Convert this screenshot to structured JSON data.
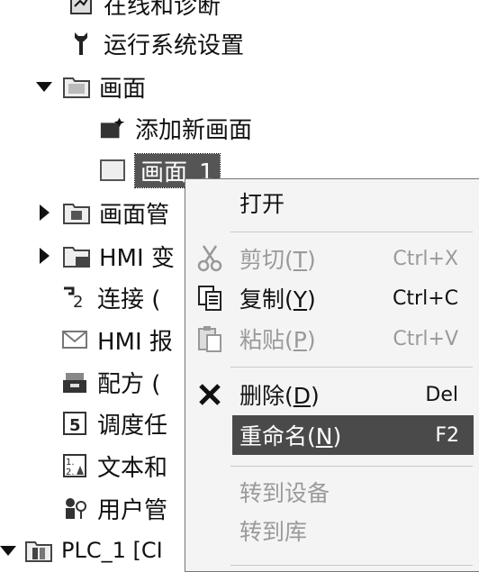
{
  "tree": {
    "items": [
      {
        "label": "在线和诊断",
        "icon": "online-diagnostics-icon"
      },
      {
        "label": "运行系统设置",
        "icon": "wrench-icon"
      },
      {
        "label": "画面",
        "icon": "folder-icon"
      },
      {
        "label": "添加新画面",
        "icon": "add-screen-icon"
      },
      {
        "label": "画面_1",
        "icon": "screen-icon"
      },
      {
        "label": "画面管",
        "icon": "screen-management-folder-icon"
      },
      {
        "label": "HMI 变",
        "icon": "hmi-tags-folder-icon"
      },
      {
        "label": "连接 (",
        "icon": "connections-icon"
      },
      {
        "label": "HMI 报",
        "icon": "hmi-alarms-icon"
      },
      {
        "label": "配方 (",
        "icon": "recipes-icon"
      },
      {
        "label": "调度任",
        "icon": "scheduler-icon"
      },
      {
        "label": "文本和",
        "icon": "text-graphics-lists-icon"
      },
      {
        "label": "用户管",
        "icon": "user-admin-icon"
      },
      {
        "label": "PLC_1 [CI",
        "icon": "plc-folder-icon"
      }
    ]
  },
  "menu": {
    "open": "打开",
    "cut": {
      "label": "剪切(",
      "key": "T",
      "end": ")",
      "shortcut": "Ctrl+X"
    },
    "copy": {
      "label": "复制(",
      "key": "Y",
      "end": ")",
      "shortcut": "Ctrl+C"
    },
    "paste": {
      "label": "粘贴(",
      "key": "P",
      "end": ")",
      "shortcut": "Ctrl+V"
    },
    "delete": {
      "label": "删除(",
      "key": "D",
      "end": ")",
      "shortcut": "Del"
    },
    "rename": {
      "label": "重命名(",
      "key": "N",
      "end": ")",
      "shortcut": "F2"
    },
    "goto_device": "转到设备",
    "goto_library": "转到库"
  },
  "colors": {
    "highlight": "#4a4a4a",
    "disabled_text": "#9a9a9a"
  }
}
